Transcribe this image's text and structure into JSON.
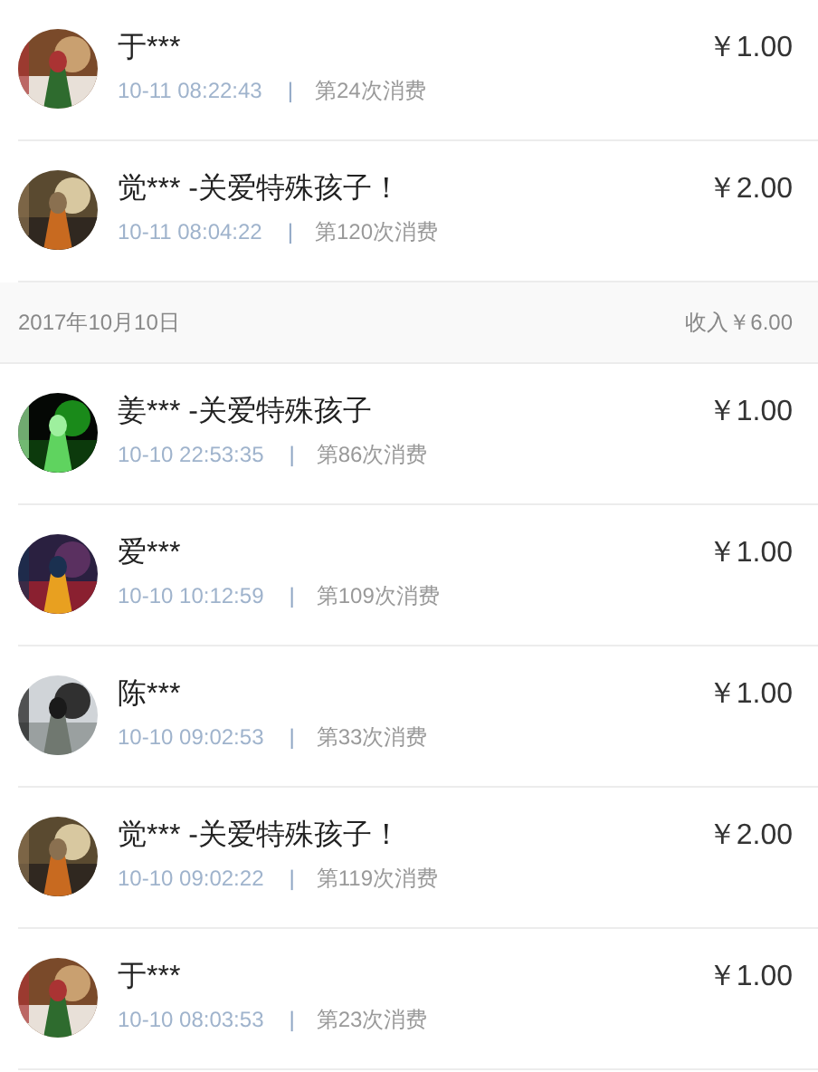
{
  "groups": [
    {
      "rows": [
        {
          "name": "于***",
          "time": "10-11 08:22:43",
          "separator": "|",
          "count": "第24次消费",
          "amount": "￥1.00"
        },
        {
          "name": "觉*** -关爱特殊孩子！",
          "time": "10-11 08:04:22",
          "separator": "|",
          "count": "第120次消费",
          "amount": "￥2.00"
        }
      ]
    },
    {
      "date": "2017年10月10日",
      "income": "收入￥6.00",
      "rows": [
        {
          "name": "姜*** -关爱特殊孩子",
          "time": "10-10 22:53:35",
          "separator": "|",
          "count": "第86次消费",
          "amount": "￥1.00"
        },
        {
          "name": "爱***",
          "time": "10-10 10:12:59",
          "separator": "|",
          "count": "第109次消费",
          "amount": "￥1.00"
        },
        {
          "name": "陈***",
          "time": "10-10 09:02:53",
          "separator": "|",
          "count": "第33次消费",
          "amount": "￥1.00"
        },
        {
          "name": "觉*** -关爱特殊孩子！",
          "time": "10-10 09:02:22",
          "separator": "|",
          "count": "第119次消费",
          "amount": "￥2.00"
        },
        {
          "name": "于***",
          "time": "10-10 08:03:53",
          "separator": "|",
          "count": "第23次消费",
          "amount": "￥1.00"
        }
      ]
    }
  ]
}
